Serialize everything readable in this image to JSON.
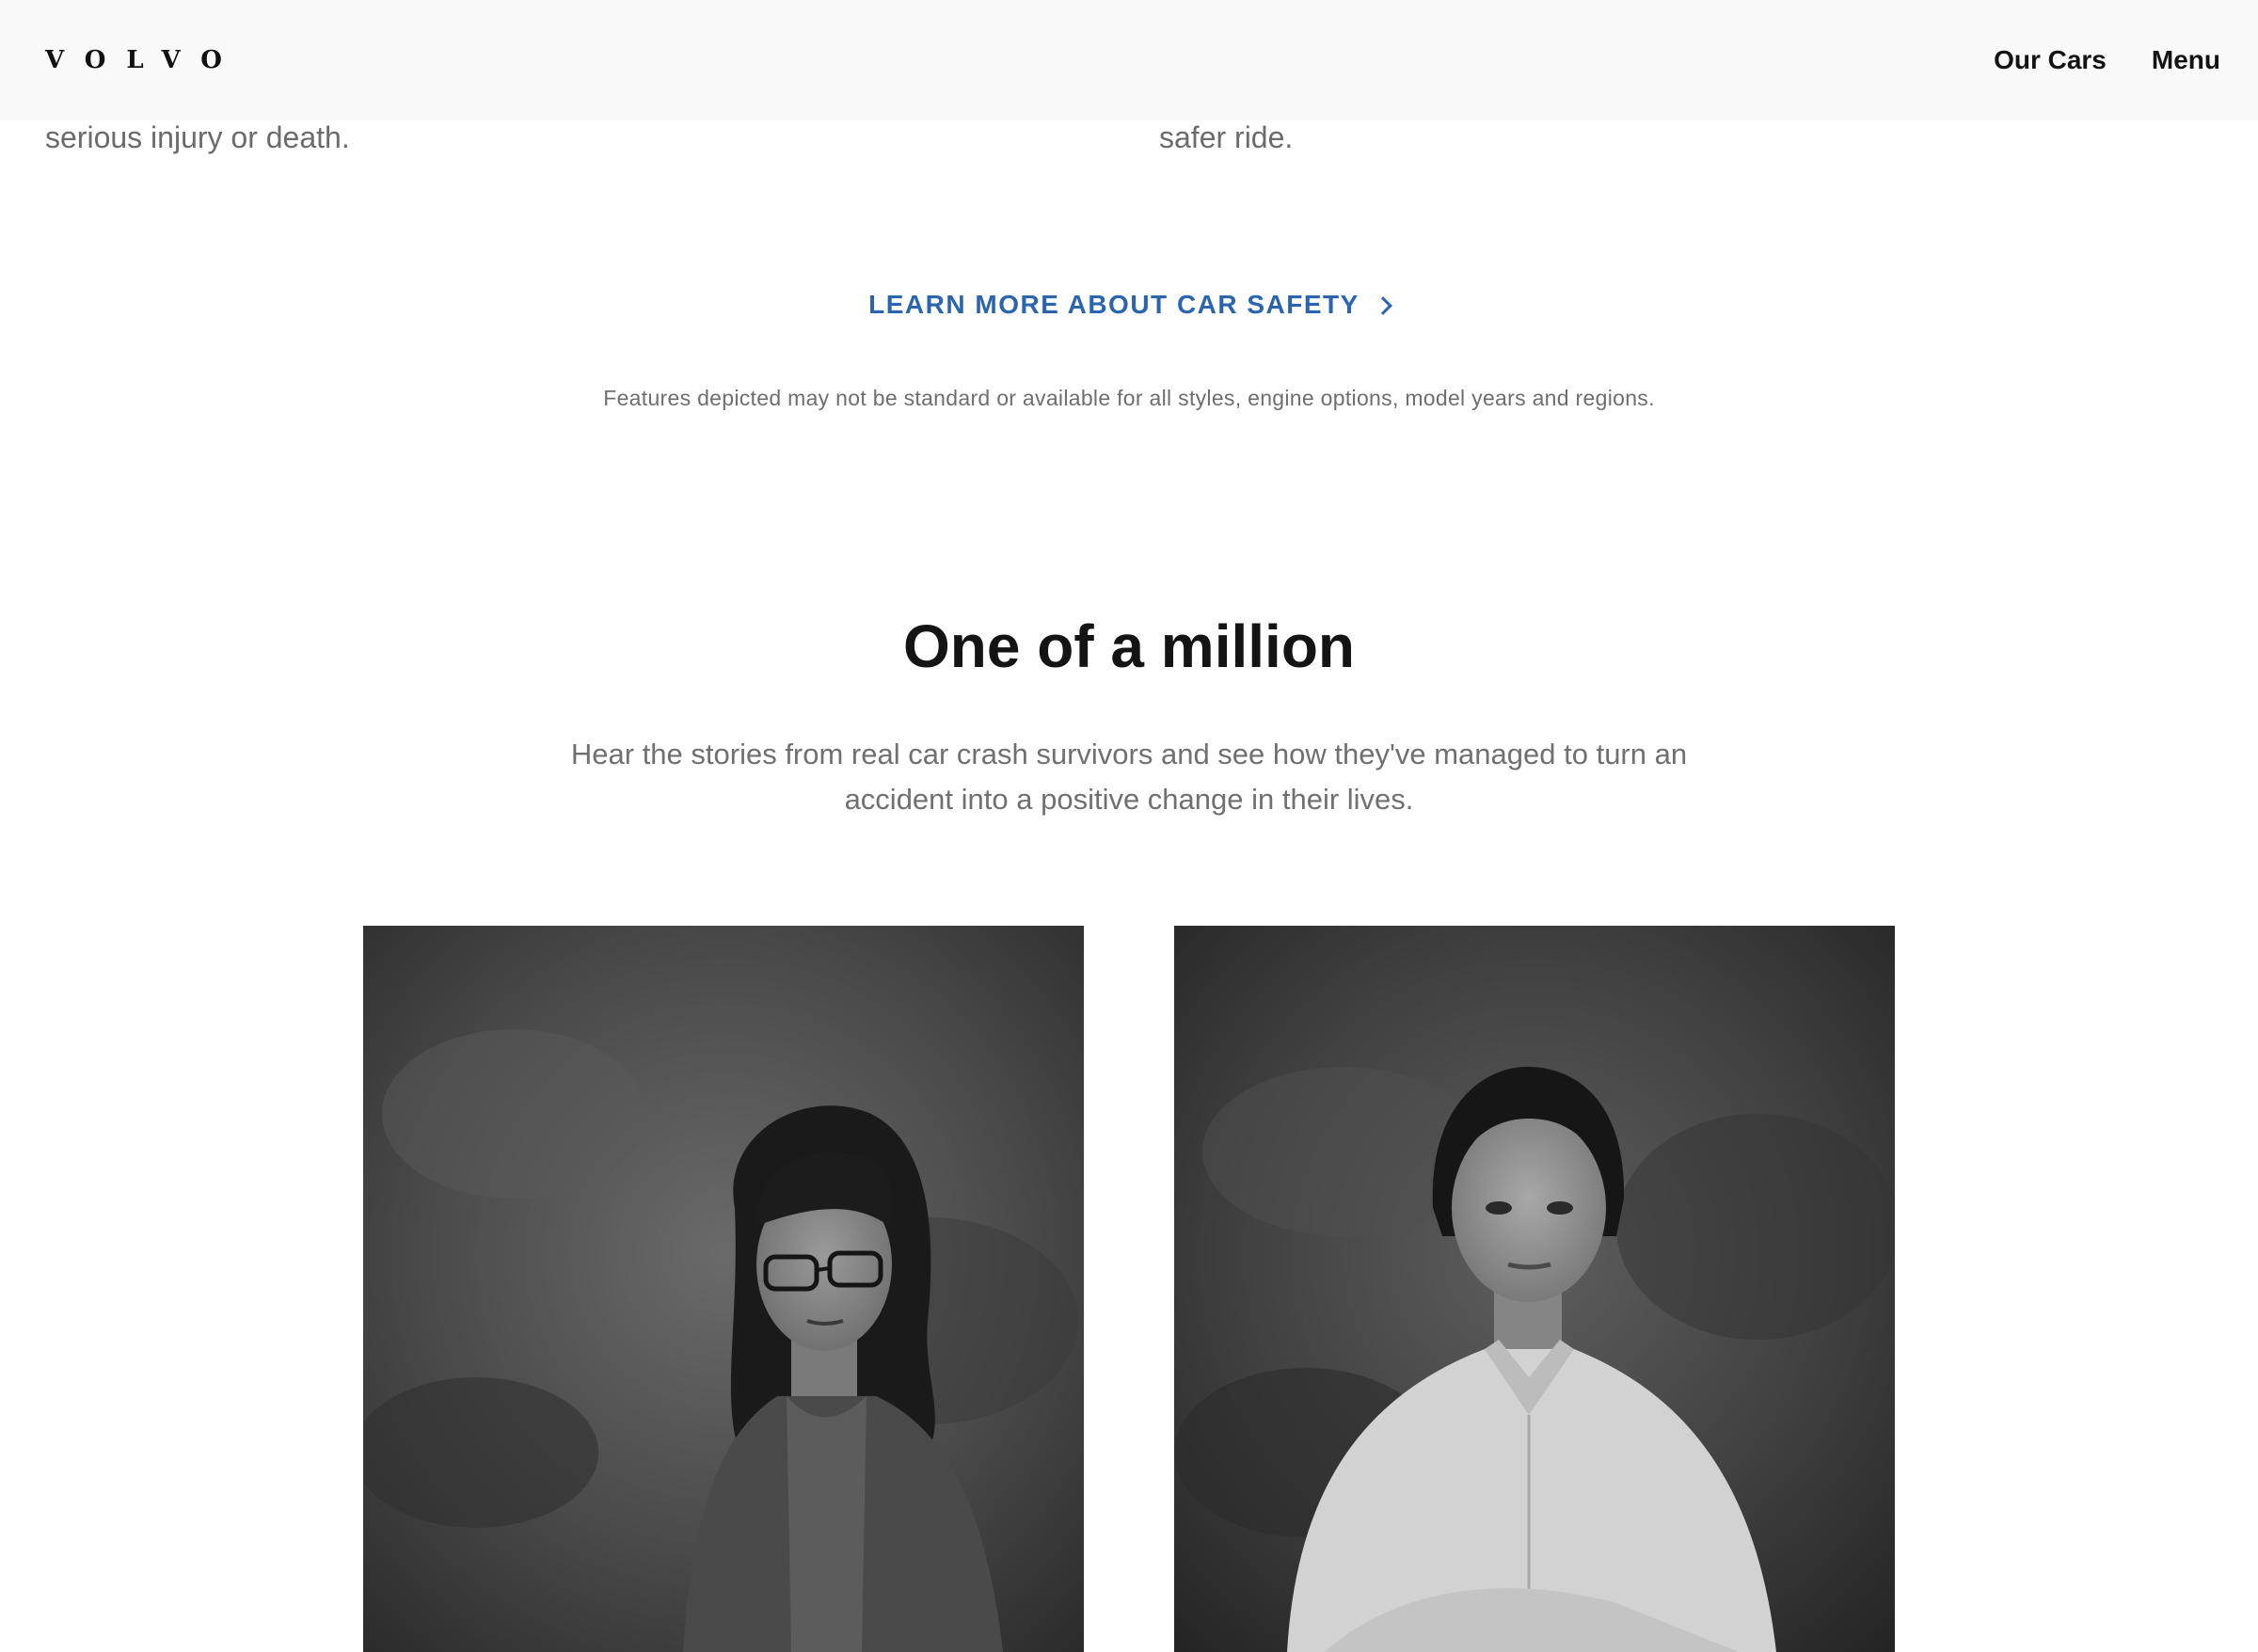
{
  "header": {
    "logo_text": "VOLVO",
    "nav": [
      "Our Cars",
      "Menu"
    ]
  },
  "previous_section": {
    "left_text_fragment": "serious injury or death.",
    "right_text_fragment": "safer ride."
  },
  "cta": {
    "label": "LEARN MORE ABOUT CAR SAFETY",
    "icon": "chevron-right-icon"
  },
  "disclaimer": "Features depicted may not be standard or available for all styles, engine options, model years and regions.",
  "stories": {
    "title": "One of a million",
    "description": "Hear the stories from real car crash survivors and see how they've managed to turn an accident into a positive change in their lives."
  },
  "colors": {
    "link_blue": "#2b65ad",
    "header_bg": "#f9f9f9",
    "heading": "#141414",
    "body_text": "#707070"
  }
}
